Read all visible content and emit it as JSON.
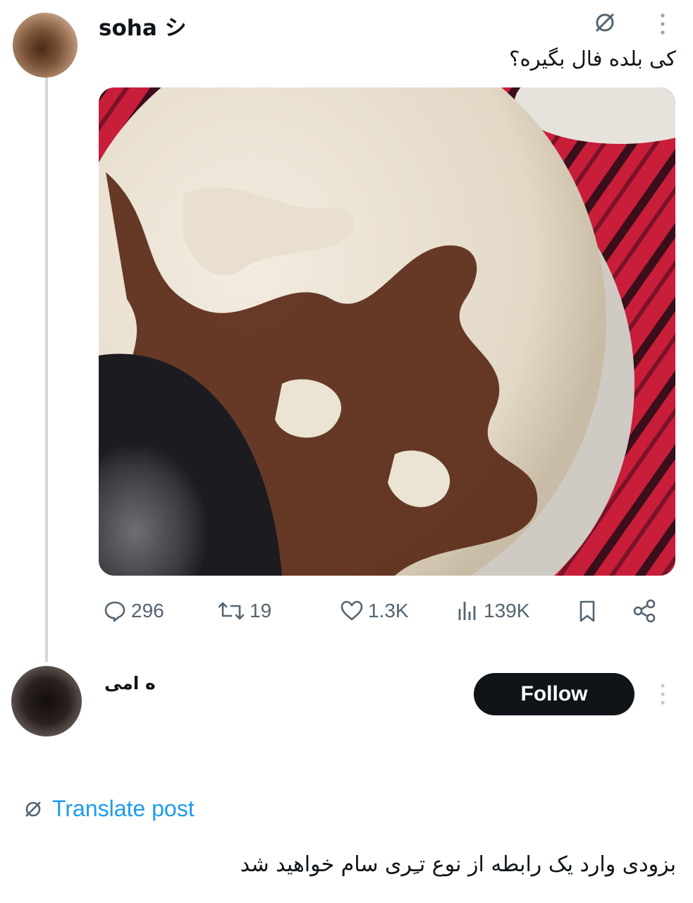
{
  "post": {
    "username": "soha シ",
    "text": "کی بلده فال بگیره؟",
    "media_alt": "coffee cup with grounds",
    "stats": {
      "replies": "296",
      "reposts": "19",
      "likes": "1.3K",
      "views": "139K"
    }
  },
  "reply": {
    "username": "ه امی",
    "follow_label": "Follow",
    "translate_label": "Translate post",
    "text": "بزودی وارد یک رابطه از نوع تـِری سام خواهید شد"
  },
  "icons": {
    "grok": "grok-icon",
    "more": "more-vertical-icon",
    "reply": "reply-icon",
    "repost": "repost-icon",
    "like": "heart-icon",
    "views": "views-icon",
    "bookmark": "bookmark-icon",
    "share": "share-icon"
  },
  "colors": {
    "text": "#0f1419",
    "muted": "#536471",
    "link": "#1d9bf0",
    "follow_bg": "#0f1419"
  }
}
